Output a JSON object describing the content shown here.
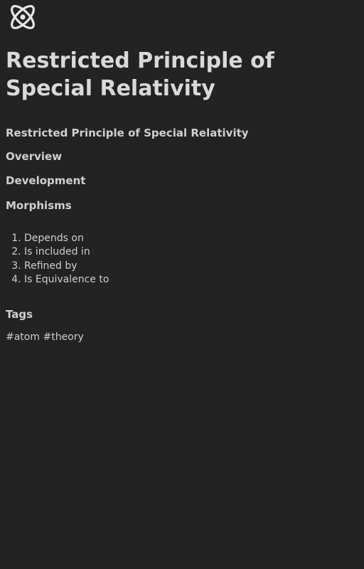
{
  "logo": {
    "icon": "atom-icon",
    "color": "#e0e0e0"
  },
  "page": {
    "title": "Restricted Principle of Special Relativity",
    "subtitle": "Restricted Principle of Special Relativity"
  },
  "nav": {
    "overview": "Overview",
    "development": "Development",
    "morphisms": "Morphisms"
  },
  "morphisms": {
    "items": [
      "Depends on",
      "Is included in",
      "Refined by",
      "Is Equivalence to"
    ]
  },
  "tags": {
    "heading": "Tags",
    "items": [
      "#atom",
      "#theory"
    ]
  },
  "colors": {
    "background": "#232323",
    "text": "#d4d4d4"
  }
}
